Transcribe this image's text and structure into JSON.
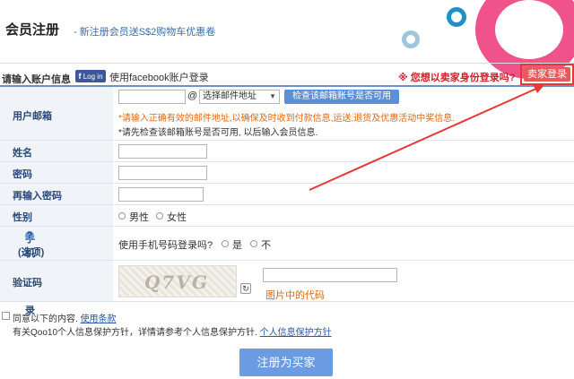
{
  "header": {
    "title": "会员注册",
    "subtitle": "- 新注册会员送S$2购物车优惠卷"
  },
  "account": {
    "label": "请输入账户信息",
    "fb_badge_f": "f",
    "fb_badge_text": "Log in",
    "fb_text": "使用facebook账户登录",
    "seller_question": "※ 您想以卖家身份登录吗?",
    "seller_button": "卖家登录"
  },
  "form": {
    "email": {
      "label": "用户邮箱",
      "at": "@",
      "domain_select": "选择邮件地址",
      "check_button": "检查该邮箱账号是否可用",
      "note1": "*请输入正确有效的邮件地址,以确保及时收到付款信息,运送,退货及优惠活动中奖信息.",
      "note2": "*请先检查该邮箱账号是否可用, 以后输入会员信息."
    },
    "name": {
      "label": "姓名"
    },
    "password": {
      "label": "密码"
    },
    "password_confirm": {
      "label": "再输入密码"
    },
    "gender": {
      "label": "性别",
      "male": "男性",
      "female": "女性"
    },
    "phone_login": {
      "label": "手机号码登录",
      "label2": "(选项)",
      "question": "使用手机号码登录吗?",
      "yes": "是",
      "no": "不"
    },
    "captcha": {
      "label": "验证码",
      "image_text": "Q7VG",
      "hint": "图片中的代码",
      "refresh_icon": "↻"
    }
  },
  "bottom": {
    "agree_text": "同意以下的内容. ",
    "terms_link": "使用条款",
    "privacy_text": "有关Qoo10个人信息保护方针，详情请参考个人信息保护方针. ",
    "privacy_link": "个人信息保护方针",
    "submit_button": "注册为买家"
  },
  "colors": {
    "accent": "#6b9be0",
    "warning": "#d0202a",
    "note": "#e06a12"
  }
}
